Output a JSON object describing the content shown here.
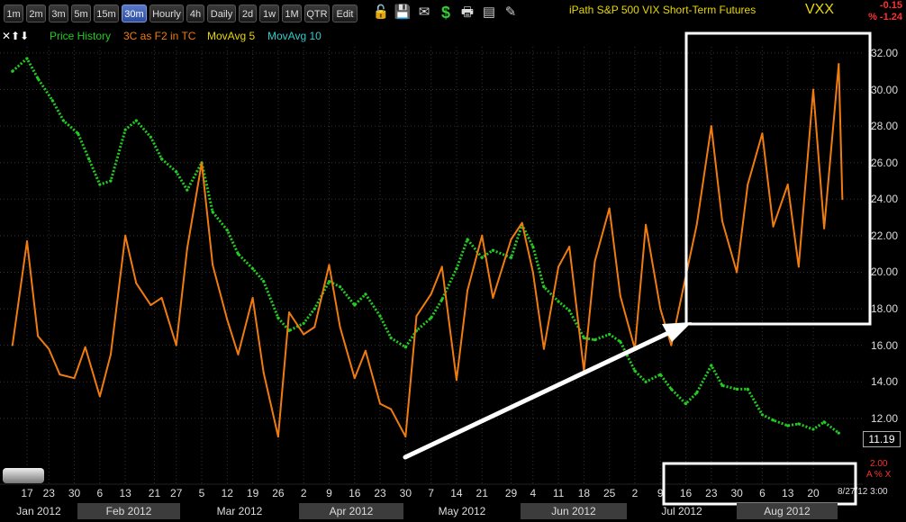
{
  "toolbar": {
    "periods": [
      "1m",
      "2m",
      "3m",
      "5m",
      "15m",
      "30m",
      "Hourly",
      "4h",
      "Daily",
      "2d",
      "1w",
      "1M",
      "QTR",
      "Edit"
    ],
    "active": "30m",
    "icons": [
      "lock-icon",
      "save-icon",
      "mail-icon",
      "dollar-icon",
      "print-icon",
      "card-icon",
      "pencil-icon"
    ]
  },
  "header": {
    "name": "iPath S&P 500 VIX Short-Term Futures",
    "symbol": "VXX",
    "change": "-0.15",
    "change_pct": "% -1.24"
  },
  "legend": {
    "price": "Price History",
    "indicator": "3C as F2 in TC",
    "ma5": "MovAvg 5",
    "ma10": "MovAvg 10"
  },
  "colors": {
    "price": "#22cc22",
    "indicator": "#f07c10",
    "ma5": "#e8d800",
    "ma10": "#33cccc",
    "change": "#ff3030"
  },
  "axis": {
    "price_ticks": [
      "32.00",
      "30.00",
      "28.00",
      "26.00",
      "24.00",
      "22.00",
      "20.00",
      "18.00",
      "16.00",
      "14.00",
      "12.00"
    ],
    "last_price": "11.19",
    "indicator_value": "2.00",
    "indicator_flags": "A % X",
    "date_stamp": "8/27/12 3:00",
    "day_ticks": [
      "17",
      "23",
      "30",
      "6",
      "13",
      "21",
      "27",
      "5",
      "12",
      "19",
      "26",
      "2",
      "9",
      "16",
      "23",
      "30",
      "7",
      "14",
      "21",
      "29",
      "4",
      "11",
      "18",
      "25",
      "2",
      "9",
      "16",
      "23",
      "30",
      "6",
      "13",
      "20"
    ],
    "months": [
      "Jan 2012",
      "Feb 2012",
      "Mar 2012",
      "Apr 2012",
      "May 2012",
      "Jun 2012",
      "Jul 2012",
      "Aug 2012"
    ]
  },
  "chart_data": {
    "type": "line",
    "title": "iPath S&P 500 VIX Short-Term Futures",
    "ylim": [
      11,
      32.5
    ],
    "series": [
      {
        "name": "Price History",
        "points": [
          [
            "Jan 13",
            31.0
          ],
          [
            "Jan 17",
            31.7
          ],
          [
            "Jan 20",
            30.6
          ],
          [
            "Jan 24",
            29.4
          ],
          [
            "Jan 27",
            28.3
          ],
          [
            "Jan 31",
            27.6
          ],
          [
            "Feb 3",
            26.2
          ],
          [
            "Feb 6",
            24.8
          ],
          [
            "Feb 9",
            25.0
          ],
          [
            "Feb 13",
            27.8
          ],
          [
            "Feb 16",
            28.3
          ],
          [
            "Feb 20",
            27.4
          ],
          [
            "Feb 23",
            26.2
          ],
          [
            "Feb 27",
            25.5
          ],
          [
            "Mar 1",
            24.5
          ],
          [
            "Mar 5",
            26.0
          ],
          [
            "Mar 8",
            23.3
          ],
          [
            "Mar 12",
            22.3
          ],
          [
            "Mar 15",
            21.0
          ],
          [
            "Mar 19",
            20.2
          ],
          [
            "Mar 22",
            19.5
          ],
          [
            "Mar 26",
            17.5
          ],
          [
            "Mar 29",
            16.8
          ],
          [
            "Apr 2",
            17.2
          ],
          [
            "Apr 5",
            18.0
          ],
          [
            "Apr 9",
            19.5
          ],
          [
            "Apr 12",
            19.2
          ],
          [
            "Apr 16",
            18.2
          ],
          [
            "Apr 19",
            18.8
          ],
          [
            "Apr 23",
            17.6
          ],
          [
            "Apr 26",
            16.4
          ],
          [
            "Apr 30",
            15.9
          ],
          [
            "May 3",
            16.8
          ],
          [
            "May 7",
            17.5
          ],
          [
            "May 10",
            18.5
          ],
          [
            "May 14",
            20.2
          ],
          [
            "May 17",
            21.8
          ],
          [
            "May 21",
            20.8
          ],
          [
            "May 24",
            21.2
          ],
          [
            "May 29",
            20.8
          ],
          [
            "Jun 1",
            22.6
          ],
          [
            "Jun 4",
            21.4
          ],
          [
            "Jun 7",
            19.2
          ],
          [
            "Jun 11",
            18.4
          ],
          [
            "Jun 14",
            17.9
          ],
          [
            "Jun 18",
            16.4
          ],
          [
            "Jun 21",
            16.3
          ],
          [
            "Jun 25",
            16.6
          ],
          [
            "Jun 28",
            16.2
          ],
          [
            "Jul 2",
            14.6
          ],
          [
            "Jul 5",
            14.0
          ],
          [
            "Jul 9",
            14.4
          ],
          [
            "Jul 12",
            13.6
          ],
          [
            "Jul 16",
            12.8
          ],
          [
            "Jul 19",
            13.4
          ],
          [
            "Jul 23",
            14.9
          ],
          [
            "Jul 26",
            13.8
          ],
          [
            "Jul 30",
            13.6
          ],
          [
            "Aug 2",
            13.6
          ],
          [
            "Aug 6",
            12.2
          ],
          [
            "Aug 9",
            11.9
          ],
          [
            "Aug 13",
            11.6
          ],
          [
            "Aug 16",
            11.7
          ],
          [
            "Aug 20",
            11.4
          ],
          [
            "Aug 23",
            11.8
          ],
          [
            "Aug 27",
            11.2
          ]
        ]
      },
      {
        "name": "3C as F2 in TC",
        "points": [
          [
            "Jan 13",
            16.0
          ],
          [
            "Jan 17",
            21.7
          ],
          [
            "Jan 20",
            16.5
          ],
          [
            "Jan 23",
            15.8
          ],
          [
            "Jan 26",
            14.4
          ],
          [
            "Jan 30",
            14.2
          ],
          [
            "Feb 2",
            15.9
          ],
          [
            "Feb 6",
            13.2
          ],
          [
            "Feb 9",
            15.5
          ],
          [
            "Feb 13",
            22.0
          ],
          [
            "Feb 16",
            19.4
          ],
          [
            "Feb 20",
            18.2
          ],
          [
            "Feb 23",
            18.6
          ],
          [
            "Feb 27",
            16.0
          ],
          [
            "Mar 1",
            21.3
          ],
          [
            "Mar 5",
            26.0
          ],
          [
            "Mar 8",
            20.4
          ],
          [
            "Mar 12",
            17.4
          ],
          [
            "Mar 15",
            15.5
          ],
          [
            "Mar 19",
            18.6
          ],
          [
            "Mar 22",
            14.5
          ],
          [
            "Mar 26",
            11.0
          ],
          [
            "Mar 29",
            17.8
          ],
          [
            "Apr 2",
            16.6
          ],
          [
            "Apr 5",
            17.0
          ],
          [
            "Apr 9",
            20.4
          ],
          [
            "Apr 12",
            17.0
          ],
          [
            "Apr 16",
            14.2
          ],
          [
            "Apr 19",
            15.7
          ],
          [
            "Apr 23",
            12.8
          ],
          [
            "Apr 26",
            12.5
          ],
          [
            "Apr 30",
            11.0
          ],
          [
            "May 3",
            17.6
          ],
          [
            "May 7",
            18.8
          ],
          [
            "May 10",
            20.3
          ],
          [
            "May 14",
            14.1
          ],
          [
            "May 17",
            19.0
          ],
          [
            "May 21",
            22.0
          ],
          [
            "May 24",
            18.6
          ],
          [
            "May 29",
            21.8
          ],
          [
            "Jun 1",
            22.7
          ],
          [
            "Jun 4",
            20.0
          ],
          [
            "Jun 7",
            15.8
          ],
          [
            "Jun 11",
            20.3
          ],
          [
            "Jun 14",
            21.4
          ],
          [
            "Jun 18",
            14.6
          ],
          [
            "Jun 21",
            20.6
          ],
          [
            "Jun 25",
            23.5
          ],
          [
            "Jun 28",
            18.7
          ],
          [
            "Jul 2",
            15.8
          ],
          [
            "Jul 5",
            22.6
          ],
          [
            "Jul 9",
            18.0
          ],
          [
            "Jul 12",
            16.0
          ],
          [
            "Jul 16",
            19.8
          ],
          [
            "Jul 19",
            22.6
          ],
          [
            "Jul 23",
            28.0
          ],
          [
            "Jul 26",
            22.8
          ],
          [
            "Jul 30",
            20.0
          ],
          [
            "Aug 2",
            24.8
          ],
          [
            "Aug 6",
            27.6
          ],
          [
            "Aug 9",
            22.5
          ],
          [
            "Aug 13",
            24.8
          ],
          [
            "Aug 16",
            20.3
          ],
          [
            "Aug 20",
            30.0
          ],
          [
            "Aug 23",
            22.4
          ],
          [
            "Aug 27",
            31.4
          ],
          [
            "Aug 28",
            24.0
          ]
        ]
      }
    ]
  }
}
